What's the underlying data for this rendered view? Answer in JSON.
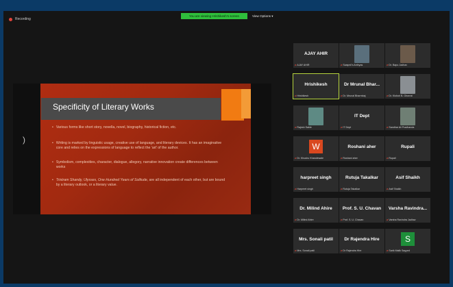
{
  "top": {
    "recording_label": "Recording",
    "viewing_banner": "You are viewing Hrishikesh's screen",
    "view_options": "View Options ▾"
  },
  "slide": {
    "title": "Specificity of Literary Works",
    "bullets": [
      "Various forms like short story, novella, novel, biography, historical fiction, etc.",
      "Writing is marked by linguistic usage, creative use of language, and literary devices. It has an imaginative core and relies on the expressions of language to reflect the 'art' of the author.",
      "Symbolism, complexities, character, dialogue, allegory, narrative innovation create differences between works",
      "Tristram Shandy, Ulysses, One Hundred Years of Solitude, are all independent of each other, but are bound by a literary outlook, or a literary value."
    ],
    "bullet4_italic": "Tristram Shandy, Ulysses, One Hundred Years of Solitude,",
    "bullet4_rest": " are all independent of each other, but are bound by a literary outlook, or a literary value.",
    "left_marker": ")"
  },
  "participants": [
    {
      "name": "AJAY AHIR",
      "label": "AJAY AHIR",
      "type": "name"
    },
    {
      "name": "",
      "label": "Swapnil's Anthyas",
      "type": "photo",
      "color": "#5a6f7c"
    },
    {
      "name": "",
      "label": "Dr. Bapu Jadhav",
      "type": "photo",
      "color": "#6b5a4a"
    },
    {
      "name": "Hrishikesh",
      "label": "Hrishikesh",
      "type": "name",
      "active": true
    },
    {
      "name": "Dr Mrunal Bhar...",
      "label": "Dr. Mrunal Bharmbaj",
      "type": "name"
    },
    {
      "name": "",
      "label": "Dr. Kishori B. Ghorrat",
      "type": "photo",
      "color": "#8a8f93"
    },
    {
      "name": "",
      "label": "Rajesh Sable",
      "type": "photo",
      "color": "#5e8a84"
    },
    {
      "name": "IT Dept",
      "label": "IT Dept",
      "type": "name"
    },
    {
      "name": "",
      "label": "Sandhar Ali Pradhanda",
      "type": "photo",
      "color": "#6f7f74"
    },
    {
      "name": "W",
      "label": "Dr. Khushu Khandewale",
      "type": "letter",
      "color": "#d9481f"
    },
    {
      "name": "Roshani aher",
      "label": "Roshani aher",
      "type": "name"
    },
    {
      "name": "Rupali",
      "label": "Rupali",
      "type": "name"
    },
    {
      "name": "harpreet singh",
      "label": "Harpreet singh",
      "type": "name"
    },
    {
      "name": "Rutuja Takalkar",
      "label": "Rutuja Takalkar",
      "type": "name"
    },
    {
      "name": "Asif Shaikh",
      "label": "Asif Shaikh",
      "type": "name"
    },
    {
      "name": "Dr. Milind Ahire",
      "label": "Dr. Milind Ahire",
      "type": "name"
    },
    {
      "name": "Prof. S. U. Chavan",
      "label": "Prof. S. U. Chavan",
      "type": "name"
    },
    {
      "name": "Varsha Ravindra...",
      "label": "Varsha Ravindra Jadhav",
      "type": "name"
    },
    {
      "name": "Mrs. Sonali patil",
      "label": "Mrs. Sonali patil",
      "type": "name"
    },
    {
      "name": "Dr Rajendra Hire",
      "label": "Dr Rajendra Hire",
      "type": "name"
    },
    {
      "name": "S",
      "label": "Sarik Malik Sayyed",
      "type": "letter",
      "color": "#1e8f3a"
    }
  ],
  "colors": {
    "frame": "#0b3a66",
    "banner": "#2fbf3c",
    "slide_orange": "#b02d12",
    "active_outline": "#b6d33c",
    "mic_muted": "#e64a3b"
  },
  "icons": [
    "recording-dot-icon",
    "chevron-down-icon",
    "mic-muted-icon"
  ]
}
